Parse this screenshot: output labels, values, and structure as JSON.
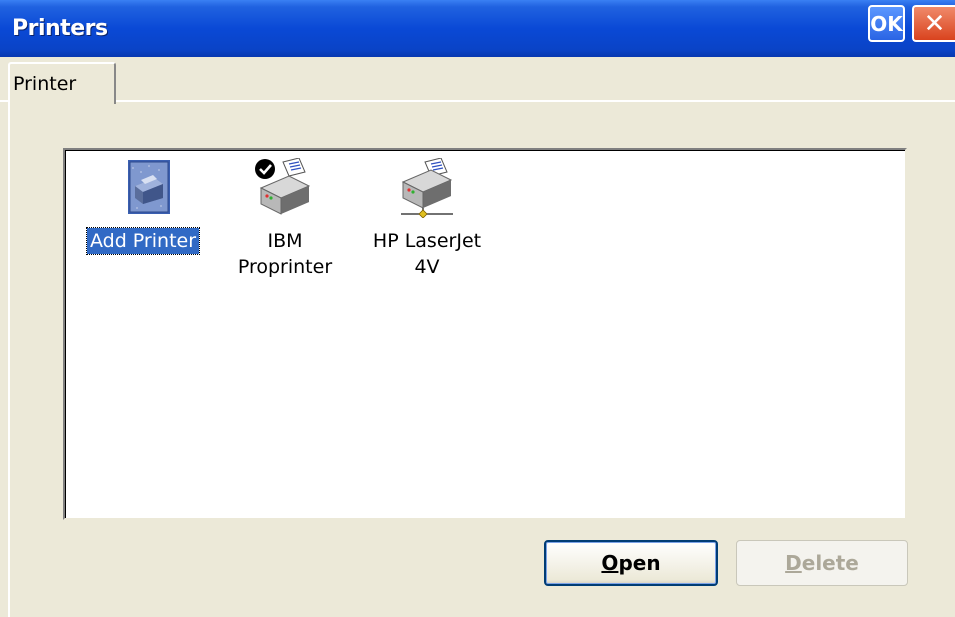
{
  "window": {
    "title": "Printers",
    "ok_label": "OK",
    "close_label": "✕"
  },
  "tabs": [
    {
      "label": "Printer",
      "active": true
    }
  ],
  "printers": [
    {
      "label": "Add Printer",
      "icon": "add-printer-icon",
      "selected": true
    },
    {
      "label_line1": "IBM",
      "label_line2": "Proprinter",
      "icon": "default-printer-icon",
      "selected": false
    },
    {
      "label_line1": "HP LaserJet",
      "label_line2": "4V",
      "icon": "network-printer-icon",
      "selected": false
    }
  ],
  "buttons": {
    "open": {
      "first": "O",
      "rest": "pen",
      "enabled": true
    },
    "delete": {
      "first": "D",
      "rest": "elete",
      "enabled": false
    }
  },
  "colors": {
    "titlebar": "#0a49d6",
    "selection": "#316ac5",
    "face": "#ece9d8"
  }
}
